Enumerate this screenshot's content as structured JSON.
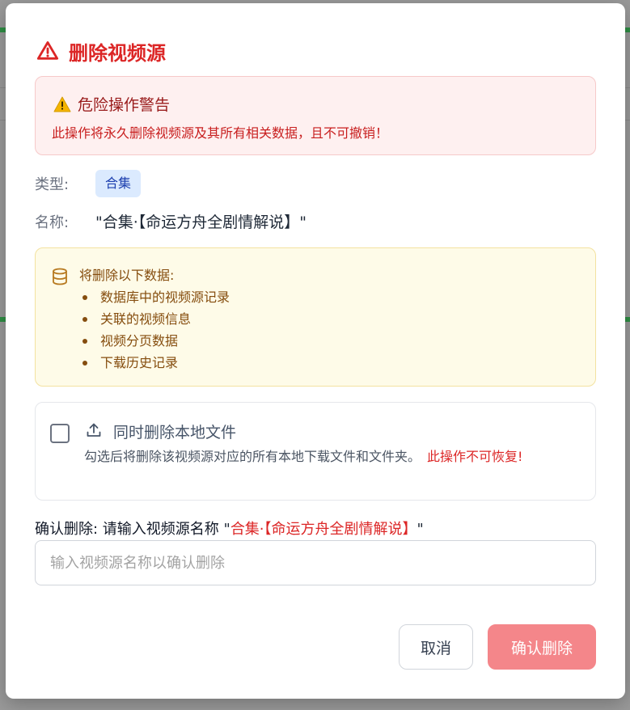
{
  "dialog": {
    "title": "删除视频源",
    "accent_color": "#dc2626",
    "title_icon": "alert-triangle-icon"
  },
  "warning": {
    "icon": "warning-emoji-icon",
    "title": "危险操作警告",
    "description": "此操作将永久删除视频源及其所有相关数据，且不可撤销！"
  },
  "source": {
    "type_label": "类型:",
    "type_value": "合集",
    "name_label": "名称:",
    "name_value": "\"合集·【命运方舟全剧情解说】\""
  },
  "data_list": {
    "icon": "database-icon",
    "title": "将删除以下数据:",
    "items": [
      "数据库中的视频源记录",
      "关联的视频信息",
      "视频分页数据",
      "下载历史记录"
    ]
  },
  "local_files": {
    "checked": false,
    "icon": "upload-icon",
    "title": "同时删除本地文件",
    "description": "勾选后将删除该视频源对应的所有本地下载文件和文件夹。",
    "irreversible_note": "此操作不可恢复!"
  },
  "confirm": {
    "label": "确认删除: 请输入视频源名称",
    "quote_open": "\"",
    "name": "合集·【命运方舟全剧情解说】",
    "quote_close": "\"",
    "placeholder": "输入视频源名称以确认删除",
    "value": ""
  },
  "actions": {
    "cancel_label": "取消",
    "confirm_label": "确认删除"
  }
}
